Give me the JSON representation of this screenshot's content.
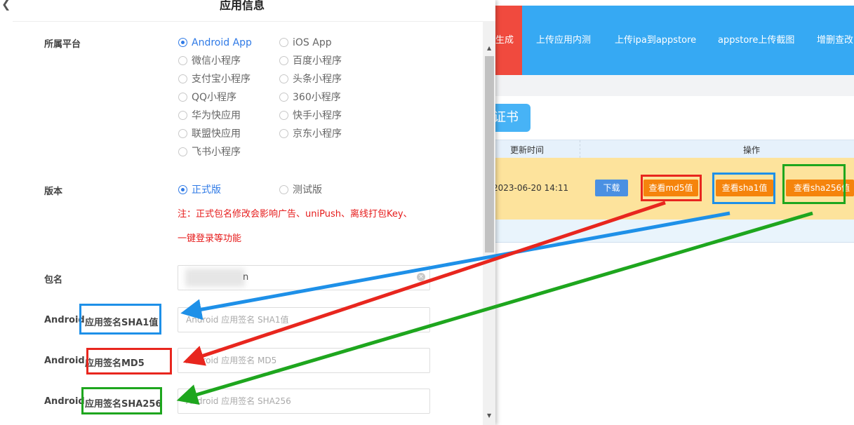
{
  "background": {
    "nav": [
      "生成",
      "上传应用内测",
      "上传ipa到appstore",
      "appstore上传截图",
      "增删查改"
    ],
    "cert_button": "证书",
    "table": {
      "headers": [
        "更新时间",
        "操作"
      ],
      "row": {
        "time": "2023-06-20 14:11",
        "actions": [
          "下载",
          "查看md5值",
          "查看sha1值",
          "查看sha256值"
        ]
      }
    },
    "colors": {
      "nav_bg": "#36a9f3",
      "nav_active": "#f04a3e",
      "row_bg": "#fde39c",
      "action_btn": "#f5840c",
      "download_btn": "#4a90e2"
    }
  },
  "modal": {
    "title": "应用信息",
    "back_icon": "chevron-left-icon",
    "platform": {
      "label": "所属平台",
      "options": [
        "Android App",
        "iOS App",
        "微信小程序",
        "百度小程序",
        "支付宝小程序",
        "头条小程序",
        "QQ小程序",
        "360小程序",
        "华为快应用",
        "快手小程序",
        "联盟快应用",
        "京东小程序",
        "飞书小程序"
      ],
      "selected": "Android App"
    },
    "version": {
      "label": "版本",
      "options": [
        "正式版",
        "测试版"
      ],
      "selected": "正式版",
      "note_line1": "注：正式包名修改会影响广告、uniPush、离线打包Key、",
      "note_line2": "一键登录等功能"
    },
    "package": {
      "label": "包名",
      "value_suffix": "n"
    },
    "sha1": {
      "label_prefix": "Android",
      "label_highlight": "应用签名SHA1值",
      "placeholder": "Android 应用签名 SHA1值"
    },
    "md5": {
      "label_prefix": "Android",
      "label_highlight": "应用签名MD5",
      "placeholder": "Android 应用签名  MD5"
    },
    "sha256": {
      "label_prefix": "Android",
      "label_highlight": "应用签名SHA256",
      "placeholder": "Android 应用签名 SHA256"
    }
  },
  "annotations": {
    "colors": {
      "sha1": "#1e90e8",
      "md5": "#e8261e",
      "sha256": "#1ea61e"
    }
  }
}
